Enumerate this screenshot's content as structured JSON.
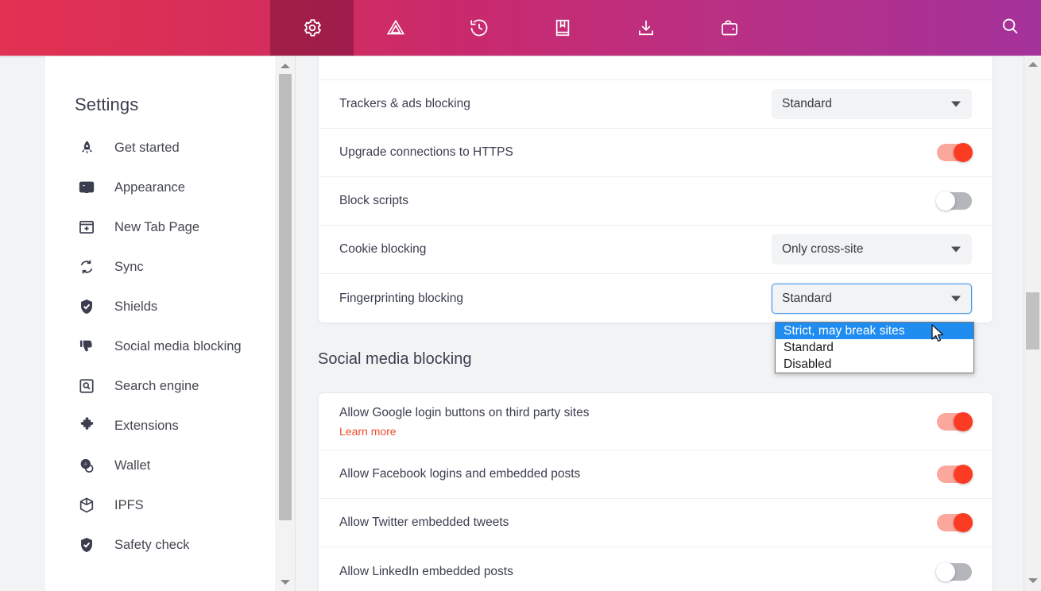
{
  "toolbar": {
    "buttons": [
      {
        "name": "settings",
        "icon": "gear-icon",
        "active": true
      },
      {
        "name": "shields",
        "icon": "brave-shields-triangle-icon",
        "active": false
      },
      {
        "name": "history",
        "icon": "history-clock-icon",
        "active": false
      },
      {
        "name": "bookmarks",
        "icon": "bookmarks-book-icon",
        "active": false
      },
      {
        "name": "downloads",
        "icon": "download-arrow-icon",
        "active": false
      },
      {
        "name": "wallet",
        "icon": "wallet-icon",
        "active": false
      }
    ],
    "search_icon": "search-icon",
    "gradient_start": "#E23152",
    "gradient_end": "#A4329B"
  },
  "sidebar": {
    "title": "Settings",
    "items": [
      {
        "label": "Get started",
        "icon": "rocket-icon"
      },
      {
        "label": "Appearance",
        "icon": "layout-icon"
      },
      {
        "label": "New Tab Page",
        "icon": "new-tab-icon"
      },
      {
        "label": "Sync",
        "icon": "sync-icon"
      },
      {
        "label": "Shields",
        "icon": "shield-check-icon"
      },
      {
        "label": "Social media blocking",
        "icon": "thumbs-down-icon"
      },
      {
        "label": "Search engine",
        "icon": "search-box-icon"
      },
      {
        "label": "Extensions",
        "icon": "puzzle-icon"
      },
      {
        "label": "Wallet",
        "icon": "wallet-coin-icon"
      },
      {
        "label": "IPFS",
        "icon": "cube-icon"
      },
      {
        "label": "Safety check",
        "icon": "shield-check-icon"
      }
    ]
  },
  "main": {
    "shields_rows": [
      {
        "label": "Trackers & ads blocking",
        "control": "select",
        "value": "Standard"
      },
      {
        "label": "Upgrade connections to HTTPS",
        "control": "toggle",
        "value": "on"
      },
      {
        "label": "Block scripts",
        "control": "toggle",
        "value": "off"
      },
      {
        "label": "Cookie blocking",
        "control": "select",
        "value": "Only cross-site"
      },
      {
        "label": "Fingerprinting blocking",
        "control": "select",
        "value": "Standard",
        "focused": true
      }
    ],
    "section_title": "Social media blocking",
    "social_rows": [
      {
        "label": "Allow Google login buttons on third party sites",
        "sublink": "Learn more",
        "control": "toggle",
        "value": "on"
      },
      {
        "label": "Allow Facebook logins and embedded posts",
        "control": "toggle",
        "value": "on"
      },
      {
        "label": "Allow Twitter embedded tweets",
        "control": "toggle",
        "value": "on"
      },
      {
        "label": "Allow LinkedIn embedded posts",
        "control": "toggle",
        "value": "off"
      }
    ]
  },
  "dropdown": {
    "open": true,
    "options": [
      {
        "label": "Strict, may break sites",
        "selected": true
      },
      {
        "label": "Standard",
        "selected": false
      },
      {
        "label": "Disabled",
        "selected": false
      }
    ],
    "highlight_color": "#1F8CF0"
  },
  "colors": {
    "toggle_on_track": "#FBA79B",
    "toggle_on_knob": "#FB3B22",
    "toggle_off_track": "#B3B6BB",
    "link": "#EE4B2B",
    "focus_border": "#4a9be8"
  }
}
